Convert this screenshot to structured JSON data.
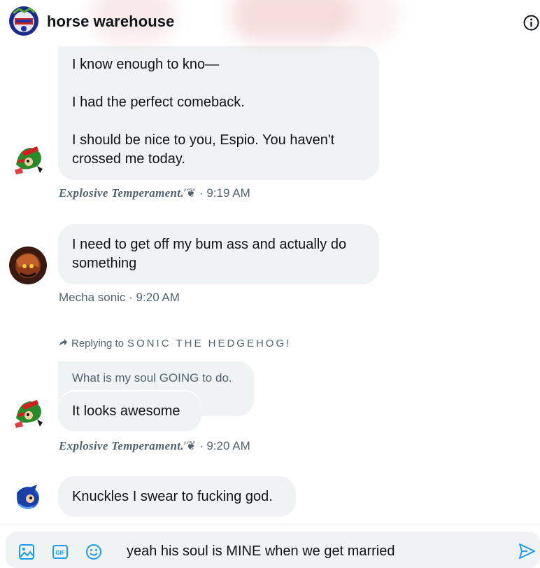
{
  "header": {
    "group_name": "horse warehouse",
    "info_icon": "info-circle-icon"
  },
  "messages": [
    {
      "sender": "Explosive Temperament.",
      "text": "I know enough to kno—\n\nI had the perfect comeback.\n\nI should be nice to you, Espio. You haven't crossed me today.",
      "suffix": "′❦",
      "time": "· 9:19 AM"
    },
    {
      "sender": "Mecha sonic",
      "text": "I need to get off my bum ass and actually do something",
      "time": "· 9:20 AM"
    },
    {
      "reply_label": "Replying to",
      "reply_target": "SONIC THE HEDGEHOG!",
      "quoted_text": "What is my soul GOING to do.",
      "sender": "Explosive Temperament.",
      "text": "It looks awesome",
      "suffix": "′❦",
      "time": "· 9:20 AM"
    },
    {
      "text": "Knuckles I swear to fucking god."
    }
  ],
  "composer": {
    "value": "yeah his soul is MINE when we get married",
    "icons": [
      "image-icon",
      "gif-icon",
      "emoji-icon",
      "send-icon"
    ],
    "gif_label": "GIF"
  },
  "colors": {
    "accent": "#1d9bf0",
    "bubble": "#eff3f4",
    "meta": "#536471"
  }
}
